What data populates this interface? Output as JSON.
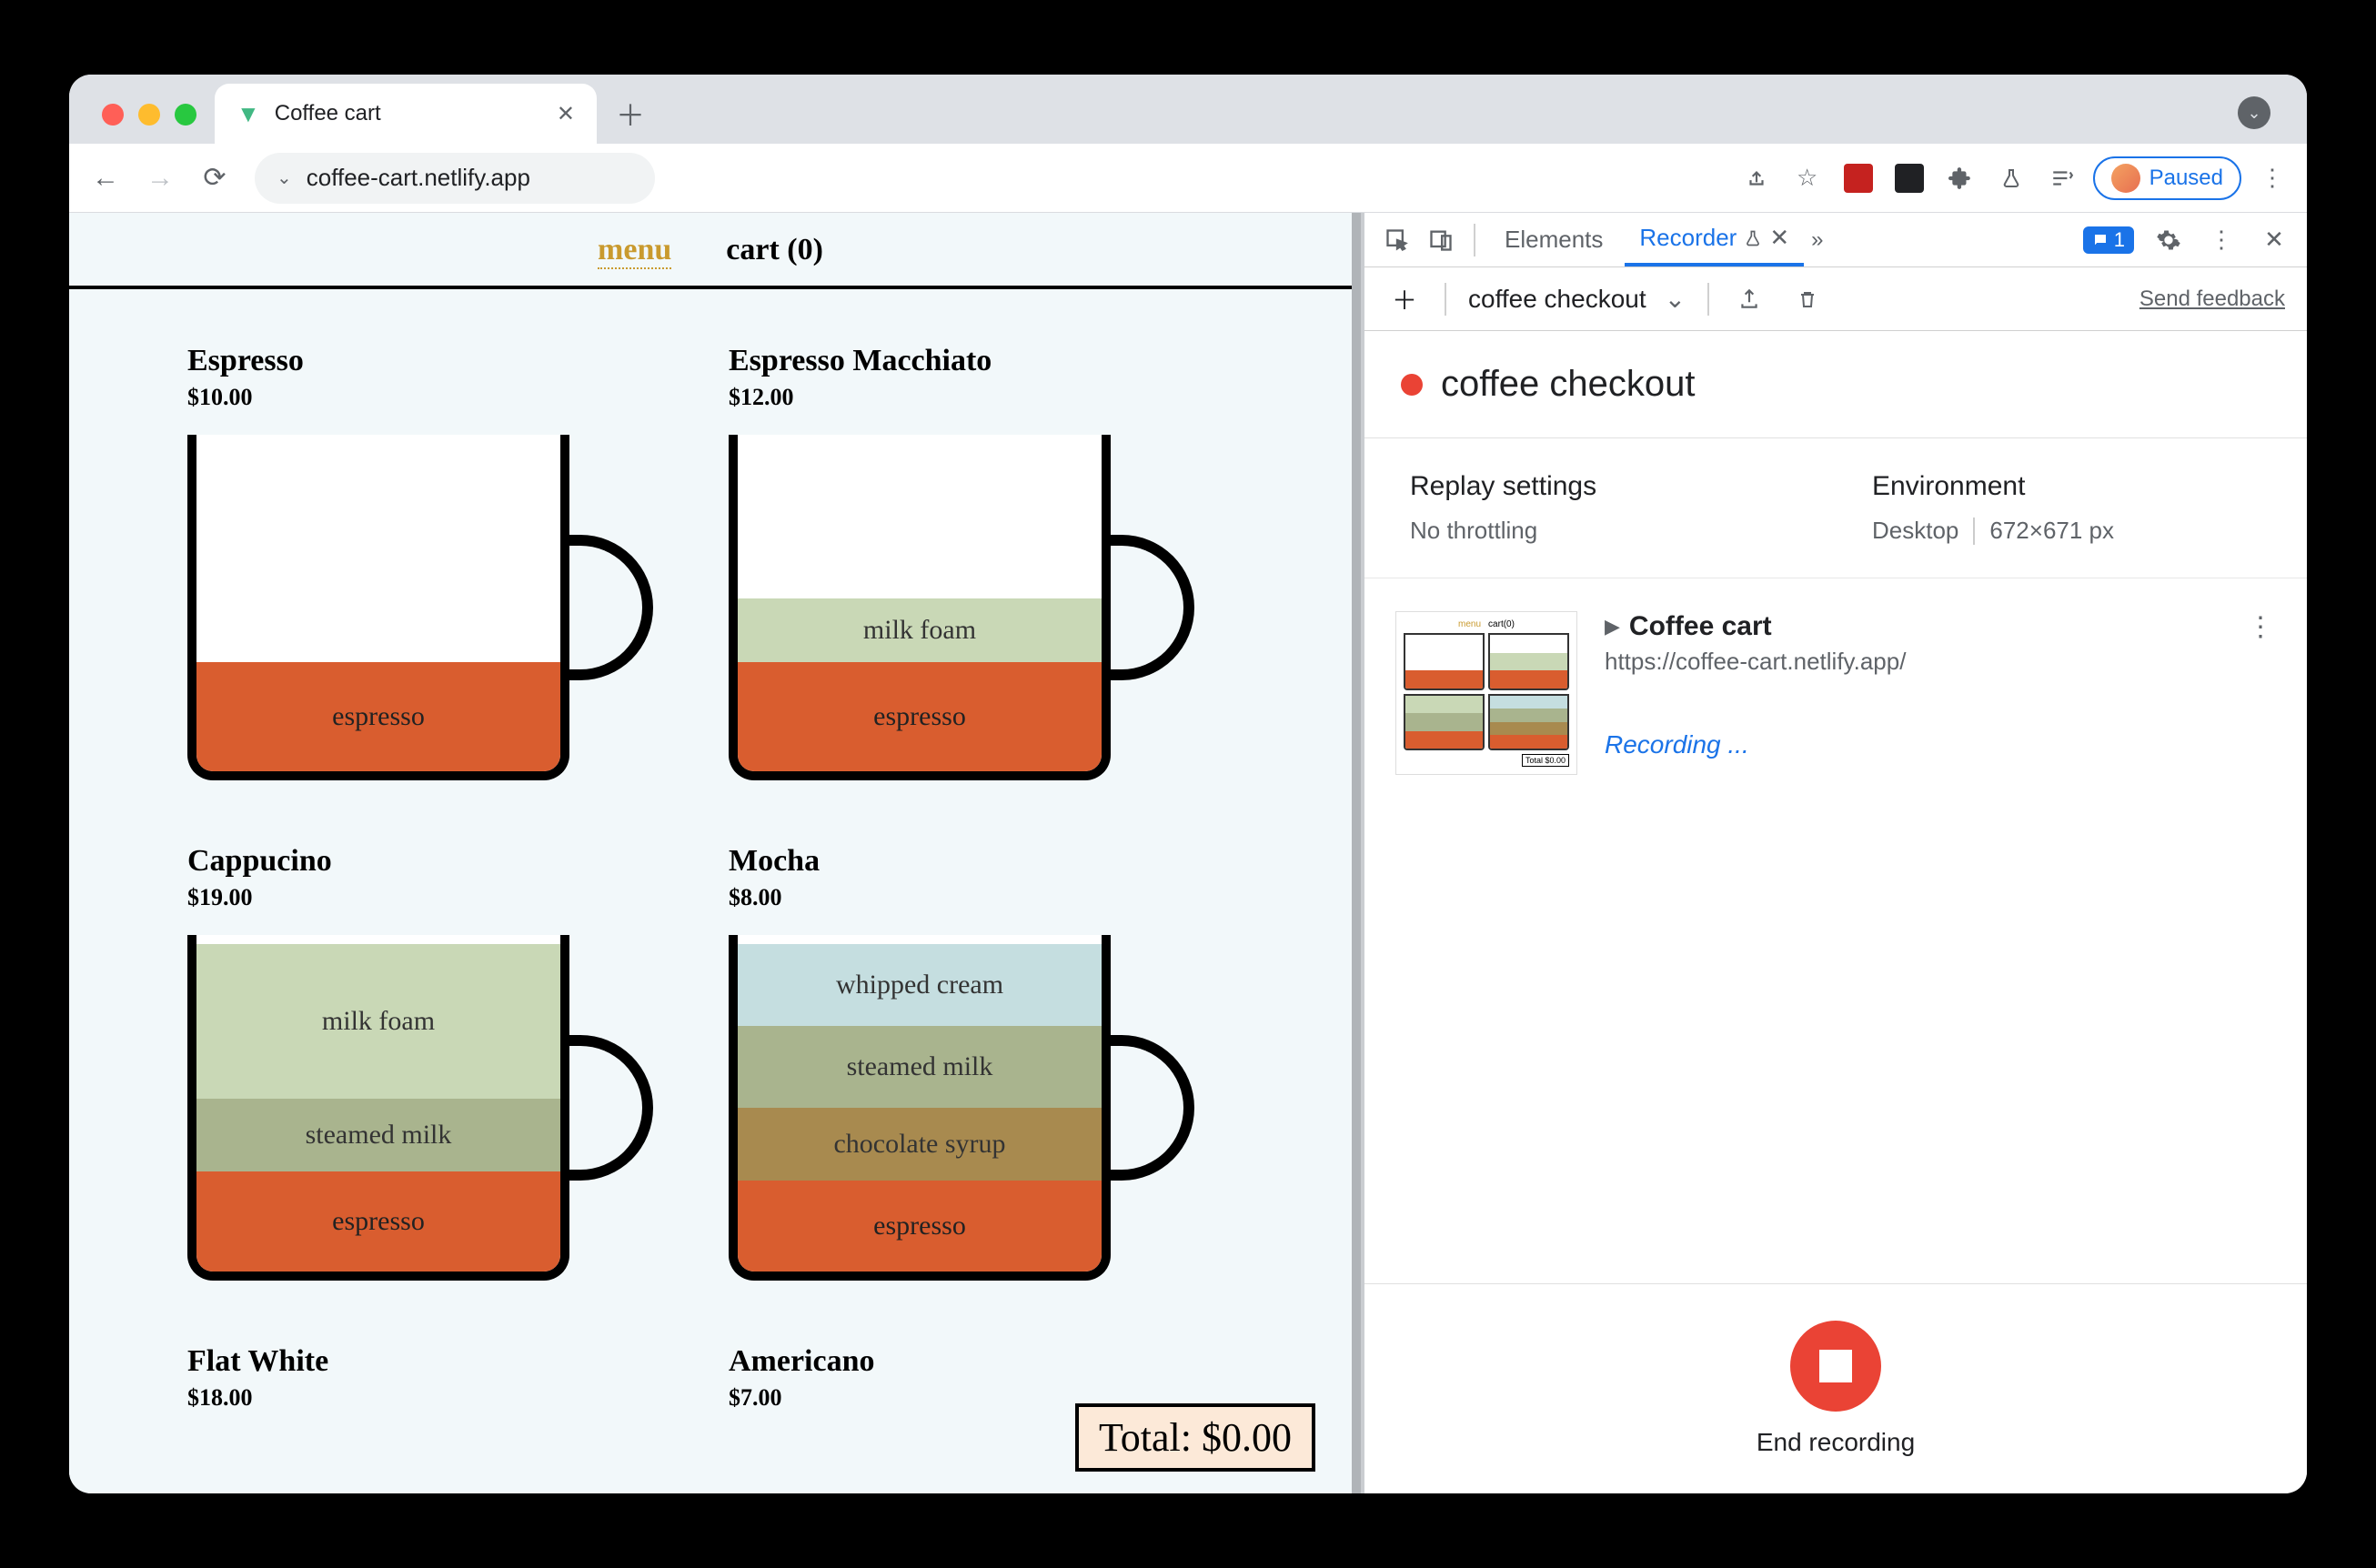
{
  "browser": {
    "tab_title": "Coffee cart",
    "url": "coffee-cart.netlify.app",
    "paused_label": "Paused"
  },
  "page": {
    "nav": {
      "menu": "menu",
      "cart": "cart (0)"
    },
    "products": [
      {
        "name": "Espresso",
        "price": "$10.00",
        "layers": [
          {
            "label": "espresso",
            "color": "c-espresso",
            "h": 120
          }
        ]
      },
      {
        "name": "Espresso Macchiato",
        "price": "$12.00",
        "layers": [
          {
            "label": "milk foam",
            "color": "c-milkfoam",
            "h": 70
          },
          {
            "label": "espresso",
            "color": "c-espresso",
            "h": 120
          }
        ]
      },
      {
        "name": "Cappucino",
        "price": "$19.00",
        "layers": [
          {
            "label": "milk foam",
            "color": "c-milkfoam",
            "h": 170
          },
          {
            "label": "steamed milk",
            "color": "c-steamed",
            "h": 80
          },
          {
            "label": "espresso",
            "color": "c-espresso",
            "h": 110
          }
        ]
      },
      {
        "name": "Mocha",
        "price": "$8.00",
        "layers": [
          {
            "label": "whipped cream",
            "color": "c-whip",
            "h": 90
          },
          {
            "label": "steamed milk",
            "color": "c-steamed",
            "h": 90
          },
          {
            "label": "chocolate syrup",
            "color": "c-choc",
            "h": 80
          },
          {
            "label": "espresso",
            "color": "c-espresso",
            "h": 100
          }
        ]
      },
      {
        "name": "Flat White",
        "price": "$18.00",
        "layers": []
      },
      {
        "name": "Americano",
        "price": "$7.00",
        "layers": []
      }
    ],
    "total_label": "Total: $0.00"
  },
  "devtools": {
    "tabs": {
      "elements": "Elements",
      "recorder": "Recorder"
    },
    "issue_count": "1",
    "recorder": {
      "flow_name": "coffee checkout",
      "feedback": "Send feedback",
      "title": "coffee checkout",
      "replay_heading": "Replay settings",
      "replay_value": "No throttling",
      "env_heading": "Environment",
      "env_device": "Desktop",
      "env_dims": "672×671 px",
      "step_title": "Coffee cart",
      "step_url": "https://coffee-cart.netlify.app/",
      "recording_text": "Recording ...",
      "end_label": "End recording"
    }
  }
}
